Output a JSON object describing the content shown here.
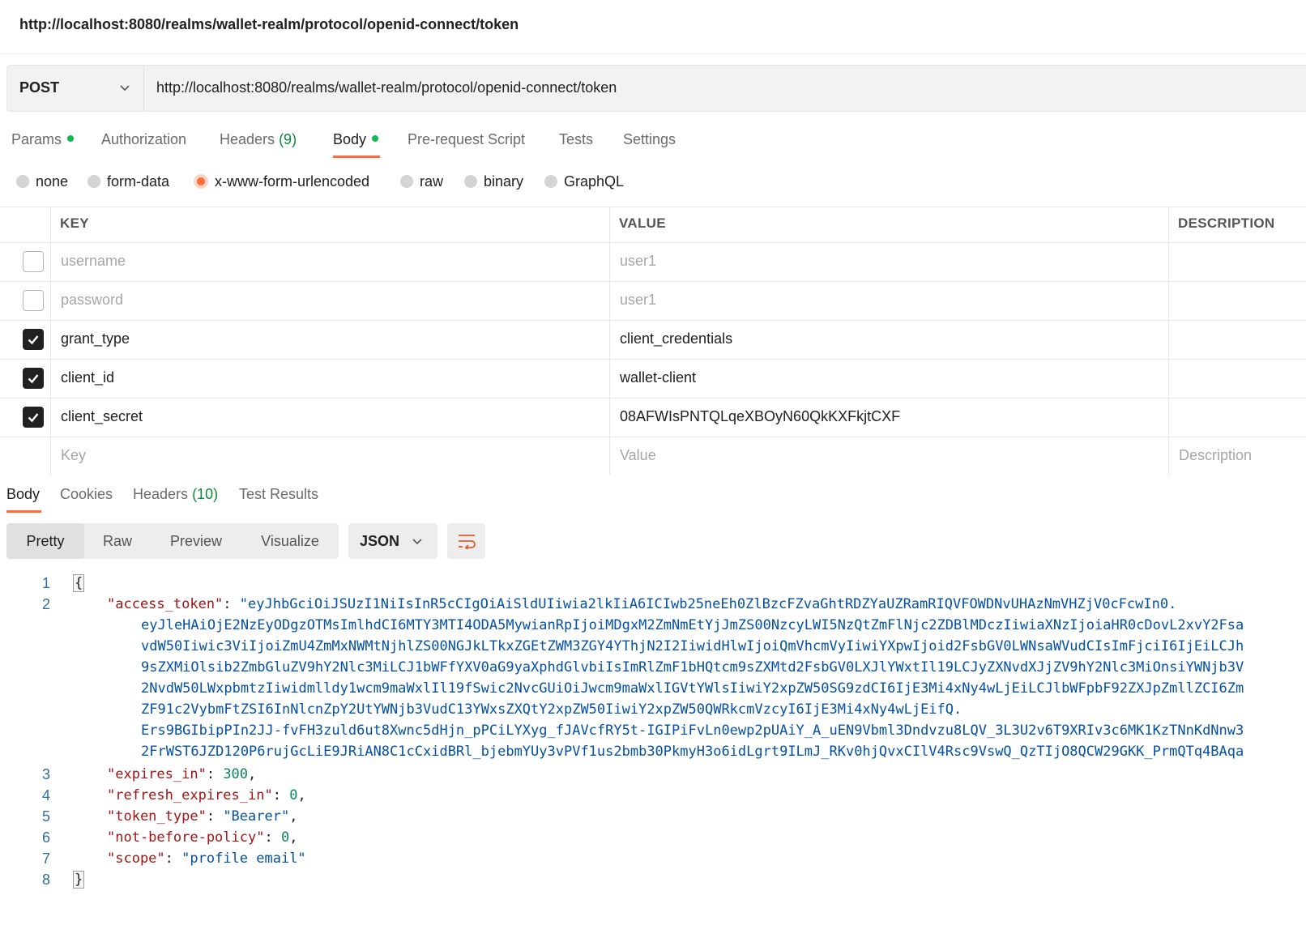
{
  "window": {
    "title": "http://localhost:8080/realms/wallet-realm/protocol/openid-connect/token"
  },
  "request": {
    "method": "POST",
    "url": "http://localhost:8080/realms/wallet-realm/protocol/openid-connect/token"
  },
  "req_tabs": {
    "params": "Params",
    "authorization": "Authorization",
    "headers": "Headers",
    "headers_count": "(9)",
    "body": "Body",
    "pre_request": "Pre-request Script",
    "tests": "Tests",
    "settings": "Settings"
  },
  "body_types": {
    "none": "none",
    "form_data": "form-data",
    "urlencoded": "x-www-form-urlencoded",
    "raw": "raw",
    "binary": "binary",
    "graphql": "GraphQL",
    "selected": "x-www-form-urlencoded"
  },
  "table": {
    "headers": {
      "key": "KEY",
      "value": "VALUE",
      "description": "DESCRIPTION"
    },
    "rows": [
      {
        "checked": false,
        "key": "username",
        "value": "user1"
      },
      {
        "checked": false,
        "key": "password",
        "value": "user1"
      },
      {
        "checked": true,
        "key": "grant_type",
        "value": "client_credentials"
      },
      {
        "checked": true,
        "key": "client_id",
        "value": "wallet-client"
      },
      {
        "checked": true,
        "key": "client_secret",
        "value": "08AFWIsPNTQLqeXBOyN60QkKXFkjtCXF"
      }
    ],
    "placeholder": {
      "key": "Key",
      "value": "Value",
      "description": "Description"
    }
  },
  "resp_tabs": {
    "body": "Body",
    "cookies": "Cookies",
    "headers": "Headers",
    "headers_count": "(10)",
    "test_results": "Test Results"
  },
  "view_modes": {
    "pretty": "Pretty",
    "raw": "Raw",
    "preview": "Preview",
    "visualize": "Visualize",
    "active": "Pretty"
  },
  "format": "JSON",
  "icons": {
    "method_dropdown": "chevron-down-icon",
    "format_dropdown": "chevron-down-icon",
    "wrap": "wrap-lines-icon",
    "checkbox": "check-icon"
  },
  "colors": {
    "accent": "#ff6c37",
    "dot_green": "#0cbb52",
    "json_key": "#a31515",
    "json_string": "#0451a5",
    "json_number": "#098658"
  },
  "response": {
    "line_numbers": [
      "1",
      "2",
      "3",
      "4",
      "5",
      "6",
      "7",
      "8"
    ],
    "open_brace": "{",
    "close_brace": "}",
    "access_token_key": "\"access_token\"",
    "access_token_lines": [
      "\"eyJhbGciOiJSUzI1NiIsInR5cCIgOiAiSldUIiwia2lkIiA6ICIwb25neEh0ZlBzcFZvaGhtRDZYaUZRamRIQVFOWDNvUHAzNmVHZjV0cFcwIn0.",
      "eyJleHAiOjE2NzEyODgzOTMsImlhdCI6MTY3MTI4ODA5MywianRpIjoiMDgxM2ZmNmEtYjJmZS00NzcyLWI5NzQtZmFlNjc2ZDBlMDczIiwiaXNzIjoiaHR0cDovL2xvY2Fsa",
      "vdW50Iiwic3ViIjoiZmU4ZmMxNWMtNjhlZS00NGJkLTkxZGEtZWM3ZGY4YThjN2I2IiwidHlwIjoiQmVhcmVyIiwiYXpwIjoid2FsbGV0LWNsaWVudCIsImFjciI6IjEiLCJh",
      "9sZXMiOlsib2ZmbGluZV9hY2Nlc3MiLCJ1bWFfYXV0aG9yaXphdGlvbiIsImRlZmF1bHQtcm9sZXMtd2FsbGV0LXJlYWxtIl19LCJyZXNvdXJjZV9hY2Nlc3MiOnsiYWNjb3V",
      "2NvdW50LWxpbmtzIiwidmlldy1wcm9maWxlIl19fSwic2NvcGUiOiJwcm9maWxlIGVtYWlsIiwiY2xpZW50SG9zdCI6IjE3Mi4xNy4wLjEiLCJlbWFpbF92ZXJpZmllZCI6Zm",
      "ZF91c2VybmFtZSI6InNlcnZpY2UtYWNjb3VudC13YWxsZXQtY2xpZW50IiwiY2xpZW50QWRkcmVzcyI6IjE3Mi4xNy4wLjEifQ.",
      "Ers9BGIbipPIn2JJ-fvFH3zuld6ut8Xwnc5dHjn_pPCiLYXyg_fJAVcfRY5t-IGIPiFvLn0ewp2pUAiY_A_uEN9Vbml3Dndvzu8LQV_3L3U2v6T9XRIv3c6MK1KzTNnKdNnw3",
      "2FrWST6JZD120P6rujGcLiE9JRiAN8C1cCxidBRl_bjebmYUy3vPVf1us2bmb30PkmyH3o6idLgrt9ILmJ_RKv0hjQvxCIlV4Rsc9VswQ_QzTIjO8QCW29GKK_PrmQTq4BAqa"
    ],
    "expires_in_key": "\"expires_in\"",
    "expires_in": "300",
    "refresh_expires_in_key": "\"refresh_expires_in\"",
    "refresh_expires_in": "0",
    "token_type_key": "\"token_type\"",
    "token_type": "\"Bearer\"",
    "not_before_policy_key": "\"not-before-policy\"",
    "not_before_policy": "0",
    "scope_key": "\"scope\"",
    "scope": "\"profile email\""
  }
}
